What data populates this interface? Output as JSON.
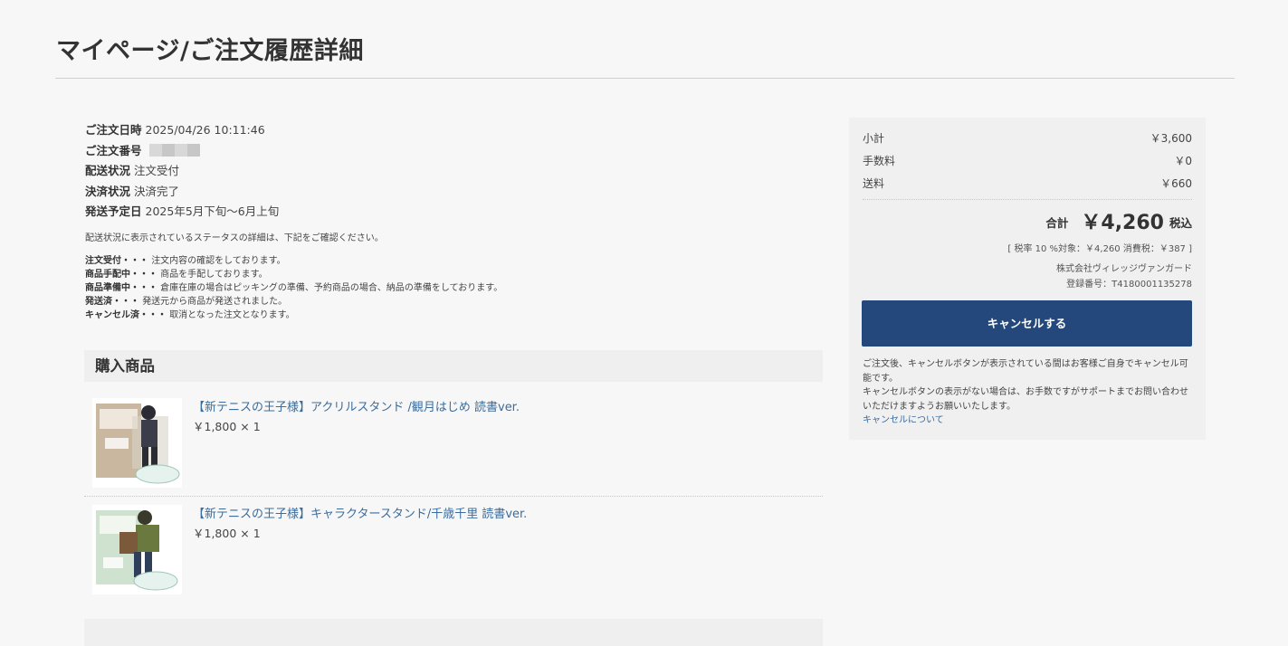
{
  "page": {
    "title": "マイページ/ご注文履歴詳細"
  },
  "order": {
    "date_label": "ご注文日時",
    "date_value": "2025/04/26 10:11:46",
    "number_label": "ご注文番号",
    "shipping_label": "配送状況",
    "shipping_value": "注文受付",
    "payment_label": "決済状況",
    "payment_value": "決済完了",
    "ship_date_label": "発送予定日",
    "ship_date_value": "2025年5月下旬〜6月上旬"
  },
  "status_note": "配送状況に表示されているステータスの詳細は、下記をご確認ください。",
  "status_legend": [
    {
      "key": "注文受付・・・",
      "desc": "注文内容の確認をしております。"
    },
    {
      "key": "商品手配中・・・",
      "desc": "商品を手配しております。"
    },
    {
      "key": "商品準備中・・・",
      "desc": "倉庫在庫の場合はピッキングの準備、予約商品の場合、納品の準備をしております。"
    },
    {
      "key": "発送済・・・",
      "desc": "発送元から商品が発送されました。"
    },
    {
      "key": "キャンセル済・・・",
      "desc": "取消となった注文となります。"
    }
  ],
  "products_section": {
    "title": "購入商品"
  },
  "products": [
    {
      "name": "【新テニスの王子様】アクリルスタンド /観月はじめ 読書ver.",
      "price": "￥1,800 × 1"
    },
    {
      "name": "【新テニスの王子様】キャラクタースタンド/千歳千里 読書ver.",
      "price": "￥1,800 × 1"
    }
  ],
  "summary": {
    "subtotal_label": "小計",
    "subtotal_value": "￥3,600",
    "fee_label": "手数料",
    "fee_value": "￥0",
    "shipping_label": "送料",
    "shipping_value": "￥660",
    "total_label": "合計",
    "total_value": "￥4,260",
    "tax_included": "税込",
    "tax_line": "[ 税率 10 %対象：￥4,260 消費税：￥387 ]",
    "company": "株式会社ヴィレッジヴァンガード",
    "registration": "登録番号：T4180001135278"
  },
  "cancel": {
    "button_label": "キャンセルする",
    "note_1": "ご注文後、キャンセルボタンが表示されている間はお客様ご自身でキャンセル可能です。",
    "note_2": "キャンセルボタンの表示がない場合は、お手数ですがサポートまでお問い合わせいただけますようお願いいたします。",
    "link_label": "キャンセルについて"
  },
  "colors": {
    "accent_button": "#24487b",
    "link": "#3a6c9d",
    "page_bg": "#f7f7f7",
    "panel_bg": "#f0f0f0"
  }
}
